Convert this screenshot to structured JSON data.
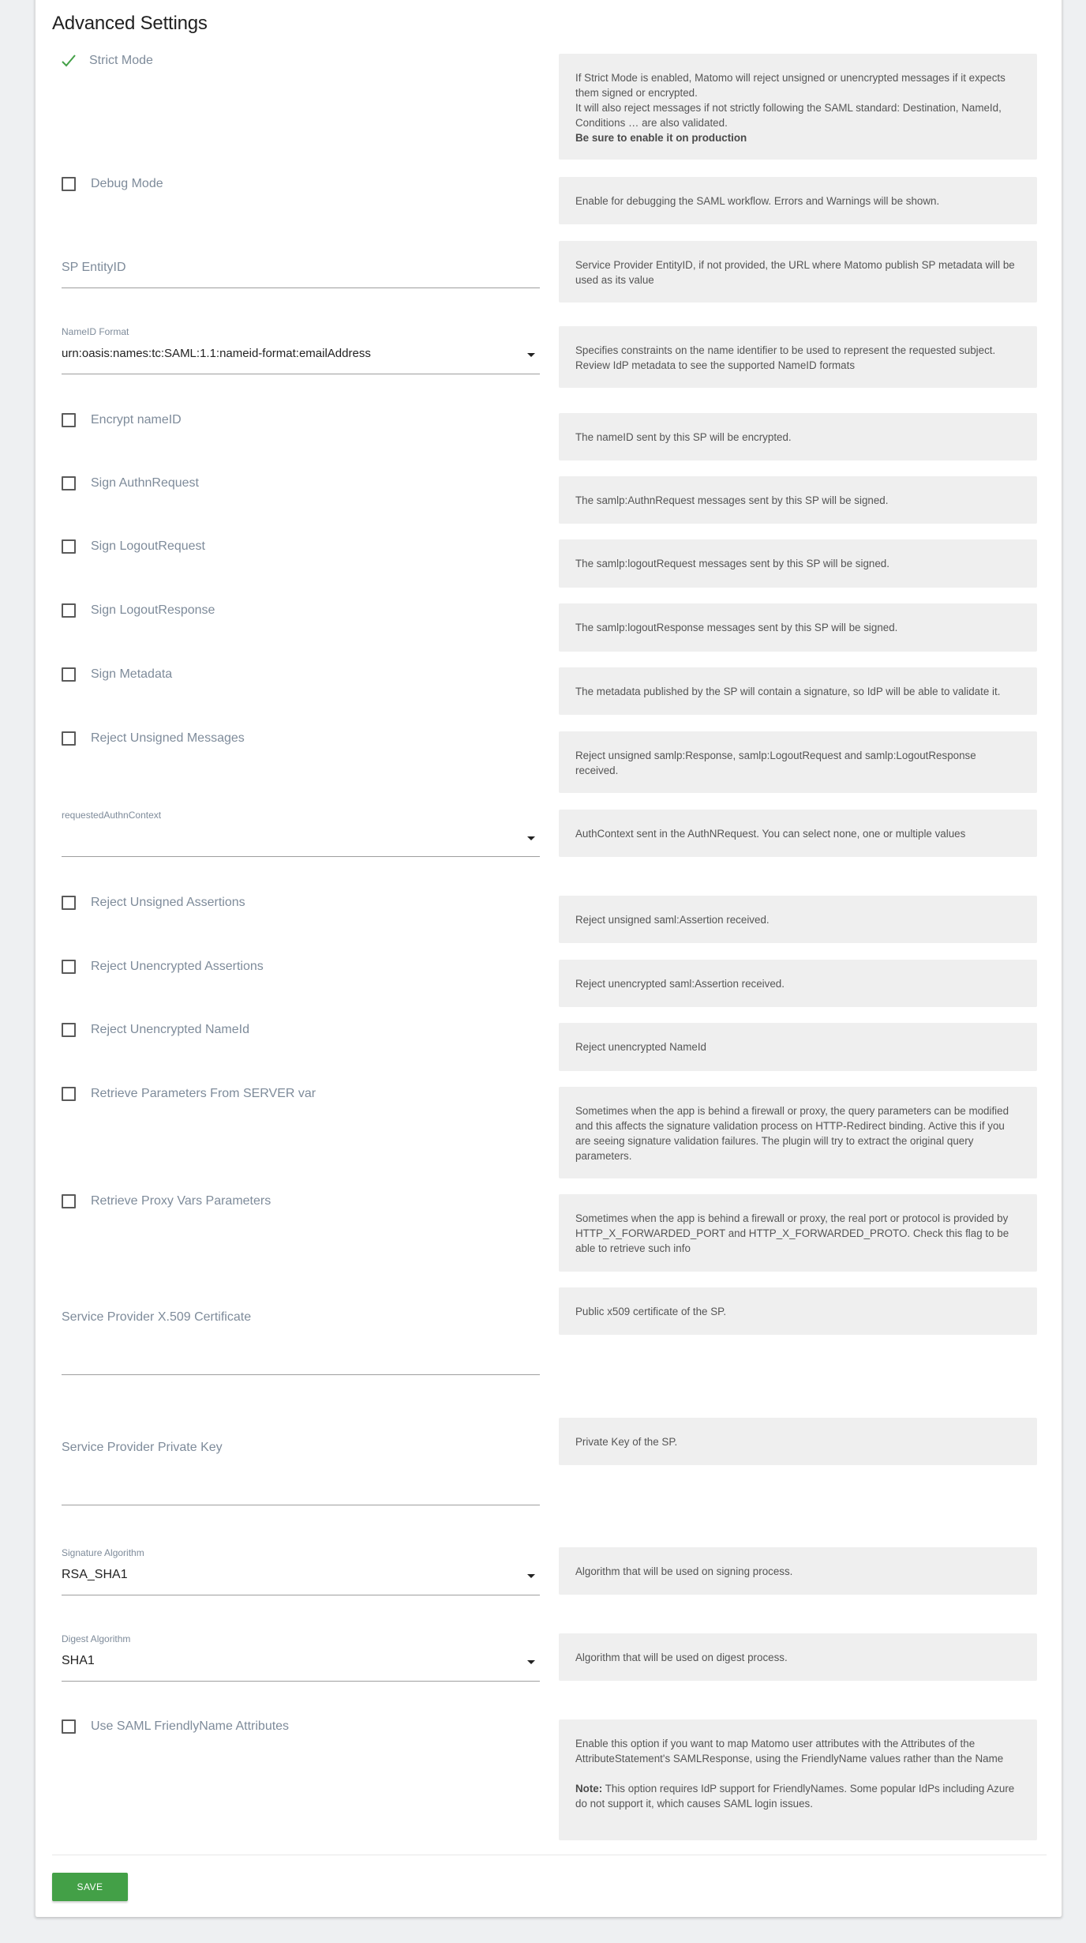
{
  "section_title": "Advanced Settings",
  "colors": {
    "accent": "#43a047",
    "help_bg": "#efefef",
    "label": "#7e8b9a",
    "page_bg": "#eef0f2"
  },
  "settings": {
    "strict_mode": {
      "label": "Strict Mode",
      "checked": true,
      "icon": "checkmark-icon",
      "help_lines": [
        "If Strict Mode is enabled, Matomo will reject unsigned or unencrypted messages if it expects them signed or encrypted.",
        "It will also reject messages if not strictly following the SAML standard: Destination, NameId, Conditions … are also validated."
      ],
      "help_bold": "Be sure to enable it on production"
    },
    "debug_mode": {
      "label": "Debug Mode",
      "checked": false,
      "help": "Enable for debugging the SAML workflow. Errors and Warnings will be shown."
    },
    "sp_entity_id": {
      "label": "SP EntityID",
      "value": "",
      "help": "Service Provider EntityID, if not provided, the URL where Matomo publish SP metadata will be used as its value"
    },
    "nameid_format": {
      "label": "NameID Format",
      "value": "urn:oasis:names:tc:SAML:1.1:nameid-format:emailAddress",
      "help": "Specifies constraints on the name identifier to be used to represent the requested subject. Review IdP metadata to see the supported NameID formats"
    },
    "encrypt_nameid": {
      "label": "Encrypt nameID",
      "checked": false,
      "help": "The nameID sent by this SP will be encrypted."
    },
    "sign_authnrequest": {
      "label": "Sign AuthnRequest",
      "checked": false,
      "help": "The samlp:AuthnRequest messages sent by this SP will be signed."
    },
    "sign_logoutrequest": {
      "label": "Sign LogoutRequest",
      "checked": false,
      "help": "The samlp:logoutRequest messages sent by this SP will be signed."
    },
    "sign_logoutresponse": {
      "label": "Sign LogoutResponse",
      "checked": false,
      "help": "The samlp:logoutResponse messages sent by this SP will be signed."
    },
    "sign_metadata": {
      "label": "Sign Metadata",
      "checked": false,
      "help": "The metadata published by the SP will contain a signature, so IdP will be able to validate it."
    },
    "reject_unsigned_messages": {
      "label": "Reject Unsigned Messages",
      "checked": false,
      "help": "Reject unsigned samlp:Response, samlp:LogoutRequest and samlp:LogoutResponse received."
    },
    "requested_authn_context": {
      "label": "requestedAuthnContext",
      "value": "",
      "help": "AuthContext sent in the AuthNRequest. You can select none, one or multiple values"
    },
    "reject_unsigned_assertions": {
      "label": "Reject Unsigned Assertions",
      "checked": false,
      "help": "Reject unsigned saml:Assertion received."
    },
    "reject_unencrypted_assertions": {
      "label": "Reject Unencrypted Assertions",
      "checked": false,
      "help": "Reject unencrypted saml:Assertion received."
    },
    "reject_unencrypted_nameid": {
      "label": "Reject Unencrypted NameId",
      "checked": false,
      "help": "Reject unencrypted NameId"
    },
    "retrieve_params_server_var": {
      "label": "Retrieve Parameters From SERVER var",
      "checked": false,
      "help": "Sometimes when the app is behind a firewall or proxy, the query parameters can be modified and this affects the signature validation process on HTTP-Redirect binding. Active this if you are seeing signature validation failures. The plugin will try to extract the original query parameters."
    },
    "retrieve_proxy_vars": {
      "label": "Retrieve Proxy Vars Parameters",
      "checked": false,
      "help": "Sometimes when the app is behind a firewall or proxy, the real port or protocol is provided by HTTP_X_FORWARDED_PORT and HTTP_X_FORWARDED_PROTO. Check this flag to be able to retrieve such info"
    },
    "sp_x509_cert": {
      "label": "Service Provider X.509 Certificate",
      "value": "",
      "help": "Public x509 certificate of the SP."
    },
    "sp_private_key": {
      "label": "Service Provider Private Key",
      "value": "",
      "help": "Private Key of the SP."
    },
    "signature_algorithm": {
      "label": "Signature Algorithm",
      "value": "RSA_SHA1",
      "help": "Algorithm that will be used on signing process."
    },
    "digest_algorithm": {
      "label": "Digest Algorithm",
      "value": "SHA1",
      "help": "Algorithm that will be used on digest process."
    },
    "use_friendlyname": {
      "label": "Use SAML FriendlyName Attributes",
      "checked": false,
      "help": "Enable this option if you want to map Matomo user attributes with the Attributes of the AttributeStatement's SAMLResponse, using the FriendlyName values rather than the Name",
      "note_label": "Note:",
      "note": " This option requires IdP support for FriendlyNames. Some popular IdPs including Azure do not support it, which causes SAML login issues."
    }
  },
  "save_button": "SAVE"
}
